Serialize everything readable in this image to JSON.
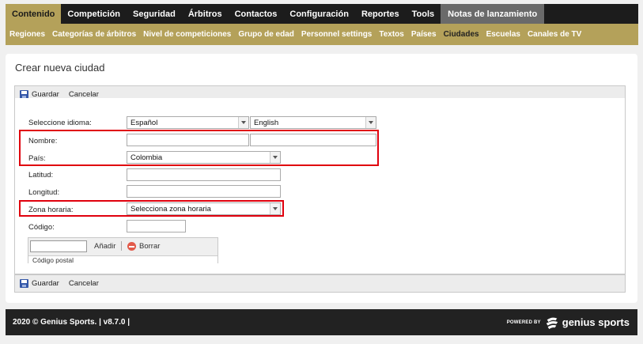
{
  "nav": {
    "items": [
      {
        "label": "Contenido"
      },
      {
        "label": "Competición"
      },
      {
        "label": "Seguridad"
      },
      {
        "label": "Árbitros"
      },
      {
        "label": "Contactos"
      },
      {
        "label": "Configuración"
      },
      {
        "label": "Reportes"
      },
      {
        "label": "Tools"
      },
      {
        "label": "Notas de lanzamiento"
      }
    ]
  },
  "subnav": {
    "items": [
      {
        "label": "Regiones"
      },
      {
        "label": "Categorías de árbitros"
      },
      {
        "label": "Nivel de competiciones"
      },
      {
        "label": "Grupo de edad"
      },
      {
        "label": "Personnel settings"
      },
      {
        "label": "Textos"
      },
      {
        "label": "Países"
      },
      {
        "label": "Ciudades"
      },
      {
        "label": "Escuelas"
      },
      {
        "label": "Canales de TV"
      }
    ]
  },
  "page": {
    "title": "Crear nueva ciudad"
  },
  "toolbar": {
    "save_label": "Guardar",
    "cancel_label": "Cancelar"
  },
  "form": {
    "language_label": "Seleccione idioma:",
    "language_1": "Español",
    "language_2": "English",
    "name_label": "Nombre:",
    "name_value_1": "",
    "name_value_2": "",
    "country_label": "País:",
    "country_value": "Colombia",
    "latitude_label": "Latitud:",
    "latitude_value": "",
    "longitude_label": "Longitud:",
    "longitude_value": "",
    "timezone_label": "Zona horaria:",
    "timezone_value": "Selecciona zona horaria",
    "code_label": "Código:",
    "code_value": ""
  },
  "postal": {
    "add_label": "Añadir",
    "delete_label": "Borrar",
    "column_header": "Código postal"
  },
  "footer": {
    "copyright": "2020 © Genius Sports. | v8.7.0 |",
    "powered_by": "POWERED BY",
    "brand": "genius sports"
  },
  "colors": {
    "nav_bg": "#1c1c1c",
    "accent_gold": "#b4a15a",
    "highlight_red": "#e0000d"
  }
}
